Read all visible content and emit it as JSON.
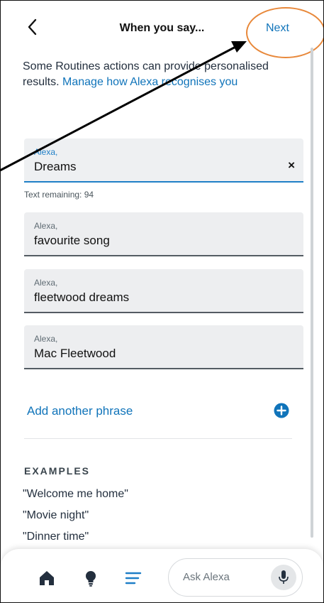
{
  "header": {
    "title": "When you say...",
    "next_label": "Next"
  },
  "intro": {
    "text": "Some Routines actions can provide personalised results. ",
    "link": "Manage how Alexa recognises you"
  },
  "phrases": [
    {
      "prefix": "Alexa,",
      "value": "Dreams",
      "active": true
    },
    {
      "prefix": "Alexa,",
      "value": "favourite song"
    },
    {
      "prefix": "Alexa,",
      "value": "fleetwood dreams"
    },
    {
      "prefix": "Alexa,",
      "value": "Mac Fleetwood"
    }
  ],
  "clear_symbol": "×",
  "counter": "Text remaining: 94",
  "add_phrase_label": "Add another phrase",
  "examples": {
    "title": "EXAMPLES",
    "items": [
      "\"Welcome me home\"",
      "\"Movie night\"",
      "\"Dinner time\""
    ]
  },
  "bottom_bar": {
    "icons": [
      "home-icon",
      "devices-bulb-icon",
      "more-menu-icon"
    ],
    "ask_placeholder": "Ask Alexa"
  },
  "colors": {
    "link": "#1074ba",
    "active_field": "#1f7fc7",
    "annotation_ring": "#e8883a"
  }
}
